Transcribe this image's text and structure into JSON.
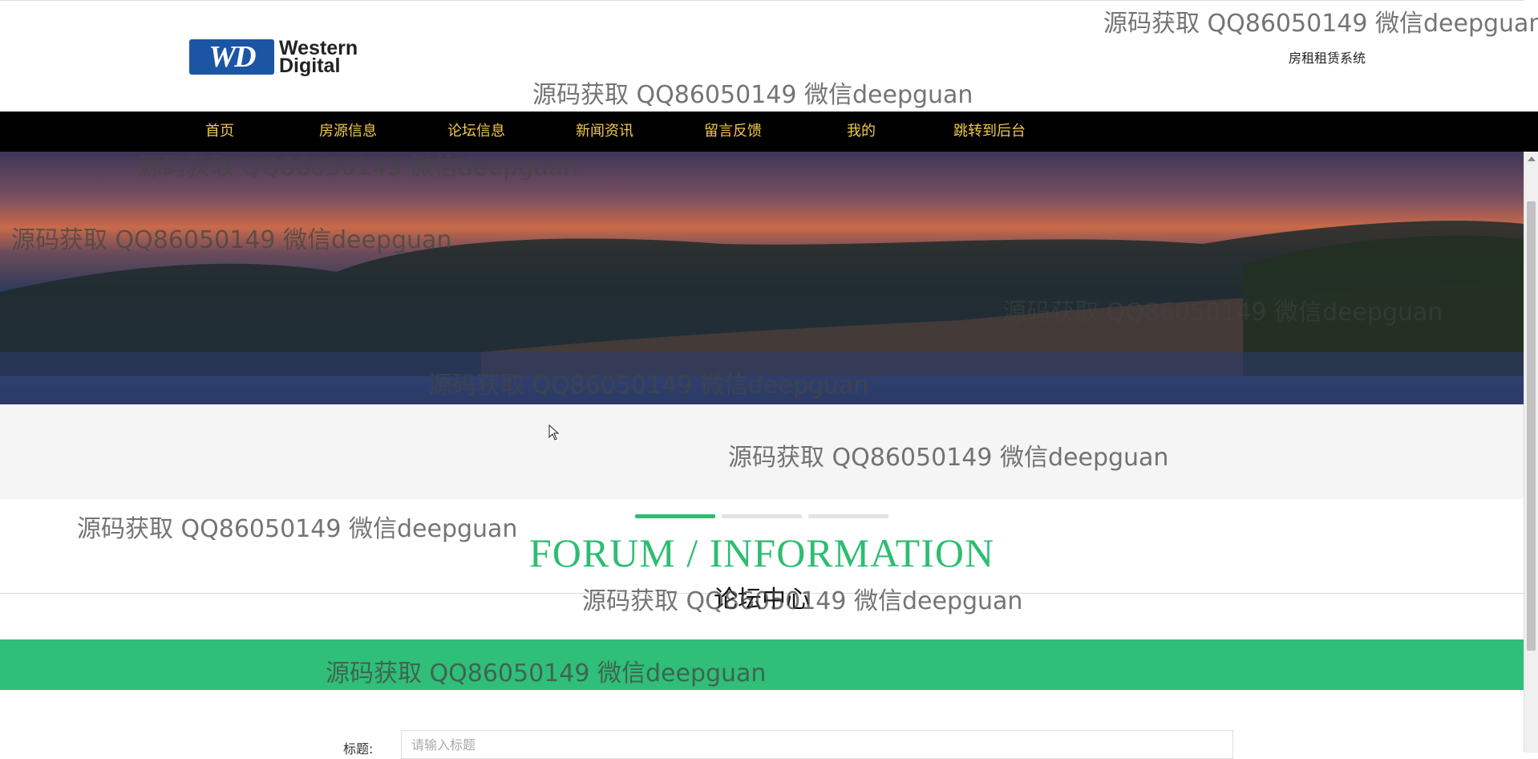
{
  "header": {
    "logo": {
      "mark": "WD",
      "name_line1": "Western",
      "name_line2": "Digital"
    },
    "system_name": "房租租赁系统"
  },
  "nav": {
    "items": [
      {
        "label": "首页"
      },
      {
        "label": "房源信息"
      },
      {
        "label": "论坛信息"
      },
      {
        "label": "新闻资讯"
      },
      {
        "label": "留言反馈"
      },
      {
        "label": "我的"
      },
      {
        "label": "跳转到后台"
      }
    ]
  },
  "section": {
    "title": "FORUM / INFORMATION",
    "subtitle": "论坛中心",
    "indicator_colors": [
      "#2dbd72",
      "#e3e3e3",
      "#e3e3e3"
    ]
  },
  "form": {
    "title_label": "标题:",
    "title_placeholder": "请输入标题"
  },
  "watermark": {
    "text": "源码获取 QQ86050149 微信deepguan"
  },
  "colors": {
    "nav_bg": "#000000",
    "nav_text": "#f2c94c",
    "accent": "#2fbf78",
    "logo_blue": "#1d55a5"
  }
}
